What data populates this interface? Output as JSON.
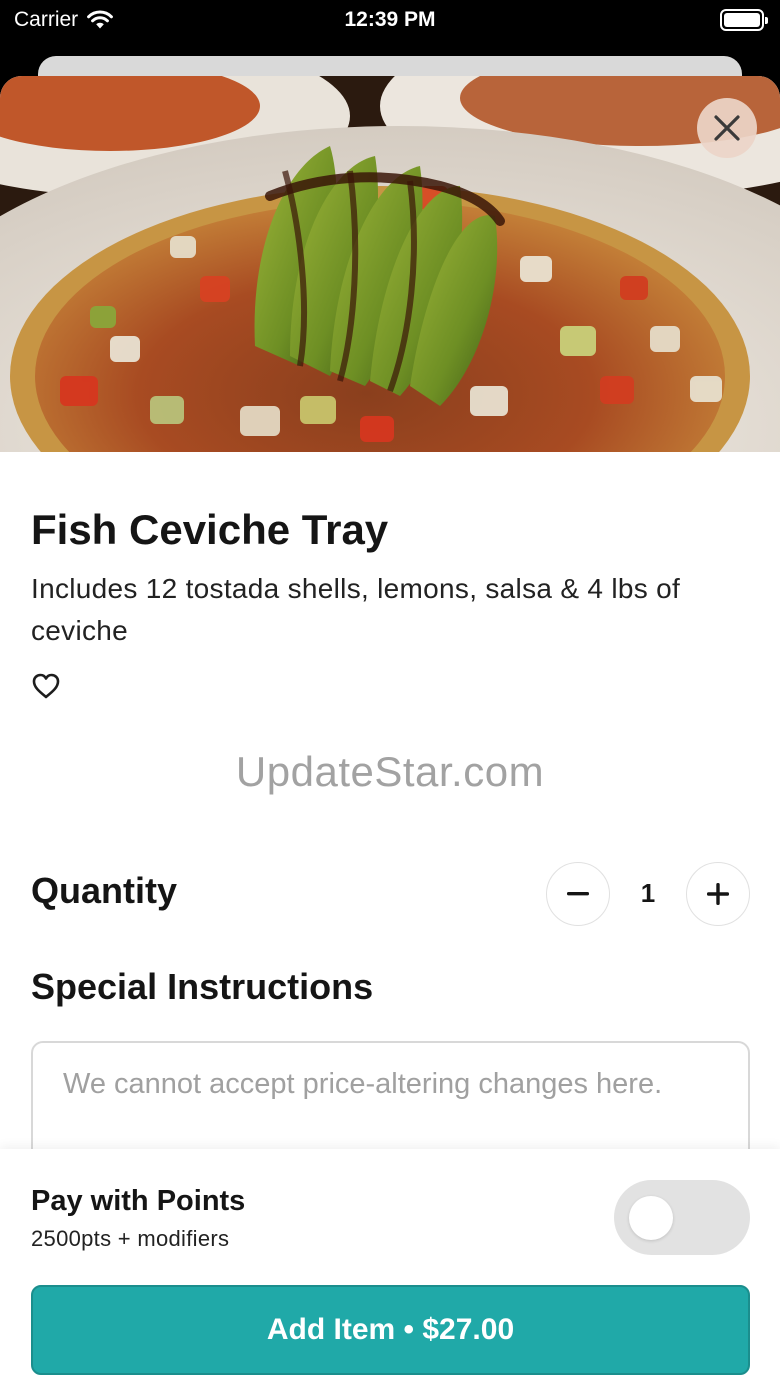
{
  "status_bar": {
    "carrier": "Carrier",
    "time": "12:39 PM"
  },
  "item": {
    "title": "Fish Ceviche Tray",
    "description": "Includes 12 tostada shells, lemons, salsa & 4 lbs of ceviche",
    "image_alt": "Fish ceviche tostada topped with sliced avocado"
  },
  "watermark": "UpdateStar.com",
  "quantity": {
    "label": "Quantity",
    "value": "1",
    "minus_icon": "minus-icon",
    "plus_icon": "plus-icon"
  },
  "special_instructions": {
    "label": "Special Instructions",
    "value": "",
    "placeholder": "We cannot accept price-altering changes here."
  },
  "points": {
    "label": "Pay with Points",
    "sublabel": "2500pts + modifiers",
    "enabled": false
  },
  "add_button": {
    "label": "Add Item • $27.00"
  },
  "icons": {
    "close": "close-icon",
    "favorite": "heart-icon",
    "wifi": "wifi-icon",
    "battery": "battery-icon"
  },
  "colors": {
    "accent": "#20a9a8",
    "toggle_off": "#e2e2e2",
    "close_button_bg": "#ecd5c8"
  }
}
